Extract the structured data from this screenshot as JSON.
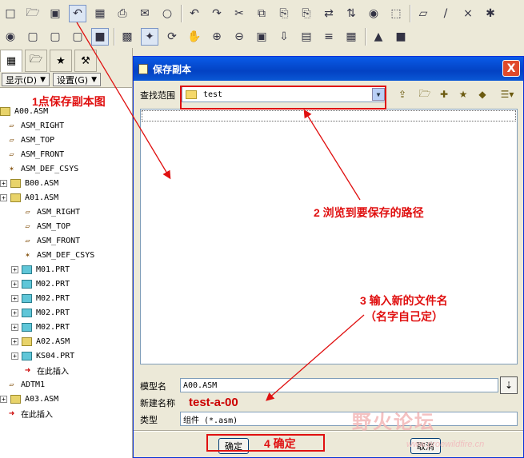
{
  "toolbar1": {
    "icons": [
      "new-icon",
      "open-icon",
      "save-icon",
      "save-copy-icon",
      "backup-icon",
      "print-icon",
      "email-icon",
      "email2-icon",
      "undo-icon",
      "redo-icon",
      "cut-icon",
      "copy-icon",
      "paste-icon",
      "paste-special-icon",
      "regenerate-icon",
      "regenerate-manager-icon",
      "find-icon",
      "select-box-icon",
      "datum-plane-display-icon",
      "datum-axis-display-icon",
      "datum-point-display-icon",
      "csys-display-icon"
    ]
  },
  "toolbar2": {
    "icons": [
      "appearance-icon",
      "wireframe-icon",
      "hidden-line-icon",
      "no-hidden-icon",
      "shading-icon",
      "repaint-icon",
      "spin-center-icon",
      "orient-icon",
      "pan-icon",
      "zoom-in-icon",
      "zoom-out-icon",
      "refit-icon",
      "reorient-icon",
      "view-manager-icon",
      "layers-icon",
      "model-setup-icon",
      "component-icon",
      "assemble-icon"
    ]
  },
  "left_panel": {
    "display_label": "显示(D)",
    "settings_label": "设置(G)",
    "tree": [
      {
        "label": "A00.ASM",
        "icon": "asm",
        "indent": 0,
        "expand": false
      },
      {
        "label": "ASM_RIGHT",
        "icon": "plane",
        "indent": 1,
        "expand": false
      },
      {
        "label": "ASM_TOP",
        "icon": "plane",
        "indent": 1,
        "expand": false
      },
      {
        "label": "ASM_FRONT",
        "icon": "plane",
        "indent": 1,
        "expand": false
      },
      {
        "label": "ASM_DEF_CSYS",
        "icon": "csys",
        "indent": 1,
        "expand": false
      },
      {
        "label": "B00.ASM",
        "icon": "asm",
        "indent": 1,
        "expand": true
      },
      {
        "label": "A01.ASM",
        "icon": "asm",
        "indent": 1,
        "expand": true
      },
      {
        "label": "ASM_RIGHT",
        "icon": "plane",
        "indent": 2,
        "expand": false
      },
      {
        "label": "ASM_TOP",
        "icon": "plane",
        "indent": 2,
        "expand": false
      },
      {
        "label": "ASM_FRONT",
        "icon": "plane",
        "indent": 2,
        "expand": false
      },
      {
        "label": "ASM_DEF_CSYS",
        "icon": "csys",
        "indent": 2,
        "expand": false
      },
      {
        "label": "M01.PRT",
        "icon": "part",
        "indent": 2,
        "expand": true
      },
      {
        "label": "M02.PRT",
        "icon": "part",
        "indent": 2,
        "expand": true
      },
      {
        "label": "M02.PRT",
        "icon": "part",
        "indent": 2,
        "expand": true
      },
      {
        "label": "M02.PRT",
        "icon": "part",
        "indent": 2,
        "expand": true
      },
      {
        "label": "M02.PRT",
        "icon": "part",
        "indent": 2,
        "expand": true
      },
      {
        "label": "A02.ASM",
        "icon": "asm",
        "indent": 2,
        "expand": true
      },
      {
        "label": "KS04.PRT",
        "icon": "part",
        "indent": 2,
        "expand": true
      },
      {
        "label": "在此插入",
        "icon": "ins",
        "indent": 2,
        "expand": false
      },
      {
        "label": "ADTM1",
        "icon": "plane",
        "indent": 1,
        "expand": false
      },
      {
        "label": "A03.ASM",
        "icon": "asm",
        "indent": 1,
        "expand": true
      },
      {
        "label": "在此插入",
        "icon": "ins",
        "indent": 1,
        "expand": false
      }
    ]
  },
  "dialog": {
    "title": "保存副本",
    "close_label": "X",
    "look_in_label": "查找范围",
    "look_in_value": "test",
    "model_name_label": "模型名",
    "model_name_value": "A00.ASM",
    "new_name_label": "新建名称",
    "new_name_value": "test-a-00",
    "type_label": "类型",
    "type_value": "组件 (*.asm)",
    "ok_label": "确定",
    "cancel_label": "取消"
  },
  "annotations": {
    "step1": "1点保存副本图",
    "step2": "2 浏览到要保存的路径",
    "step3_line1": "3 输入新的文件名",
    "step3_line2": "（名字自己定）",
    "step4": "4 确定"
  },
  "watermark": {
    "text": "野火论坛",
    "url": "www.proewildfire.cn"
  },
  "colors": {
    "annotation_red": "#e01010",
    "title_blue": "#0342c3",
    "window_bg": "#ece9d8"
  }
}
